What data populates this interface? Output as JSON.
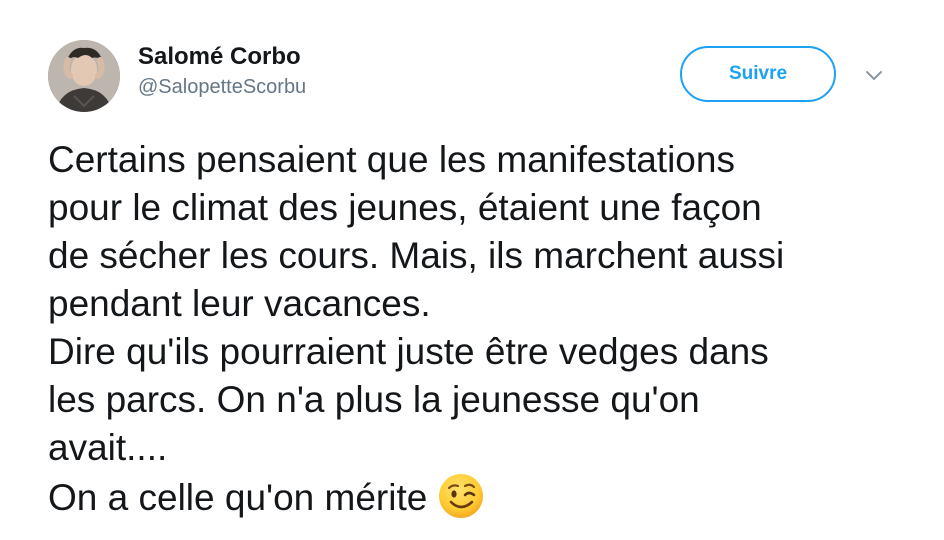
{
  "user": {
    "display_name": "Salomé Corbo",
    "handle": "@SalopetteScorbu"
  },
  "follow_button": {
    "label": "Suivre"
  },
  "tweet": {
    "lines": [
      "Certains pensaient que les manifestations",
      "pour le climat des jeunes, étaient une façon",
      "de sécher les cours. Mais, ils marchent aussi",
      "pendant leur vacances.",
      "Dire qu'ils pourraient juste être vedges dans",
      "les parcs. On n'a plus la jeunesse qu'on",
      "avait....",
      "On a celle qu'on mérite"
    ],
    "emoji": "winking-face"
  },
  "colors": {
    "accent": "#1da1f2",
    "text": "#14171a",
    "secondary_text": "#657786"
  },
  "icons": [
    "avatar-photo",
    "chevron-down-icon",
    "winking-face-emoji"
  ]
}
